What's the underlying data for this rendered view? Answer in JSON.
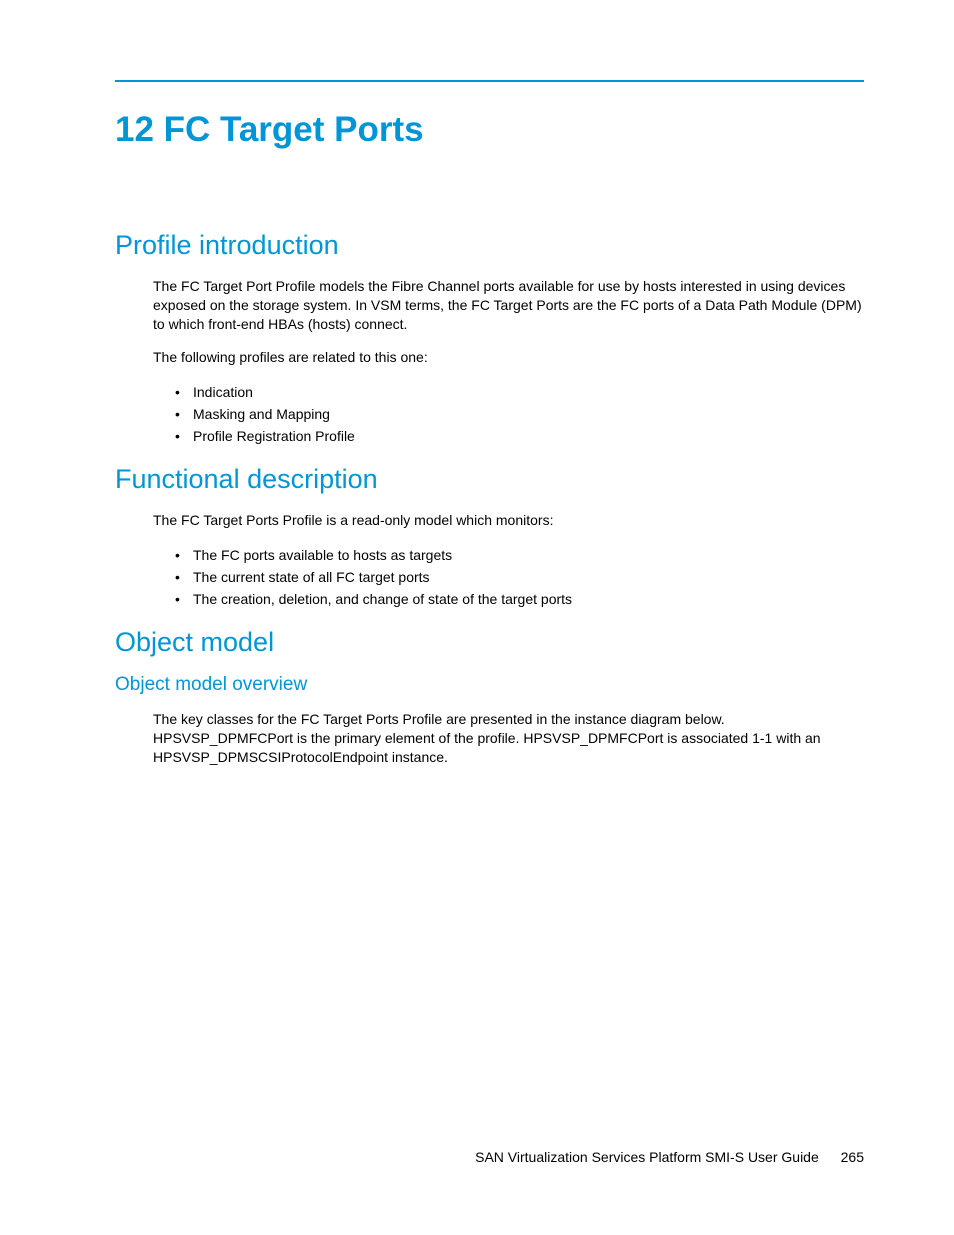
{
  "chapter": {
    "title": "12 FC Target Ports"
  },
  "sections": {
    "profile_intro": {
      "heading": "Profile introduction",
      "para1": "The FC Target Port Profile models the Fibre Channel ports available for use by hosts interested in using devices exposed on the storage system. In VSM terms, the FC Target Ports are the FC ports of a Data Path Module (DPM) to which front-end HBAs (hosts) connect.",
      "para2": "The following profiles are related to this one:",
      "bullets": [
        "Indication",
        "Masking and Mapping",
        "Profile Registration Profile"
      ]
    },
    "functional_desc": {
      "heading": "Functional description",
      "para1": "The FC Target Ports Profile is a read-only model which monitors:",
      "bullets": [
        "The FC ports available to hosts as targets",
        "The current state of all FC target ports",
        "The creation, deletion, and change of state of the target ports"
      ]
    },
    "object_model": {
      "heading": "Object model",
      "overview": {
        "heading": "Object model overview",
        "para1": "The key classes for the FC Target Ports Profile are presented in the instance diagram below. HPSVSP_DPMFCPort is the primary element of the profile. HPSVSP_DPMFCPort is associated 1-1 with an HPSVSP_DPMSCSIProtocolEndpoint instance."
      }
    }
  },
  "footer": {
    "title": "SAN Virtualization Services Platform SMI-S User Guide",
    "page": "265"
  }
}
